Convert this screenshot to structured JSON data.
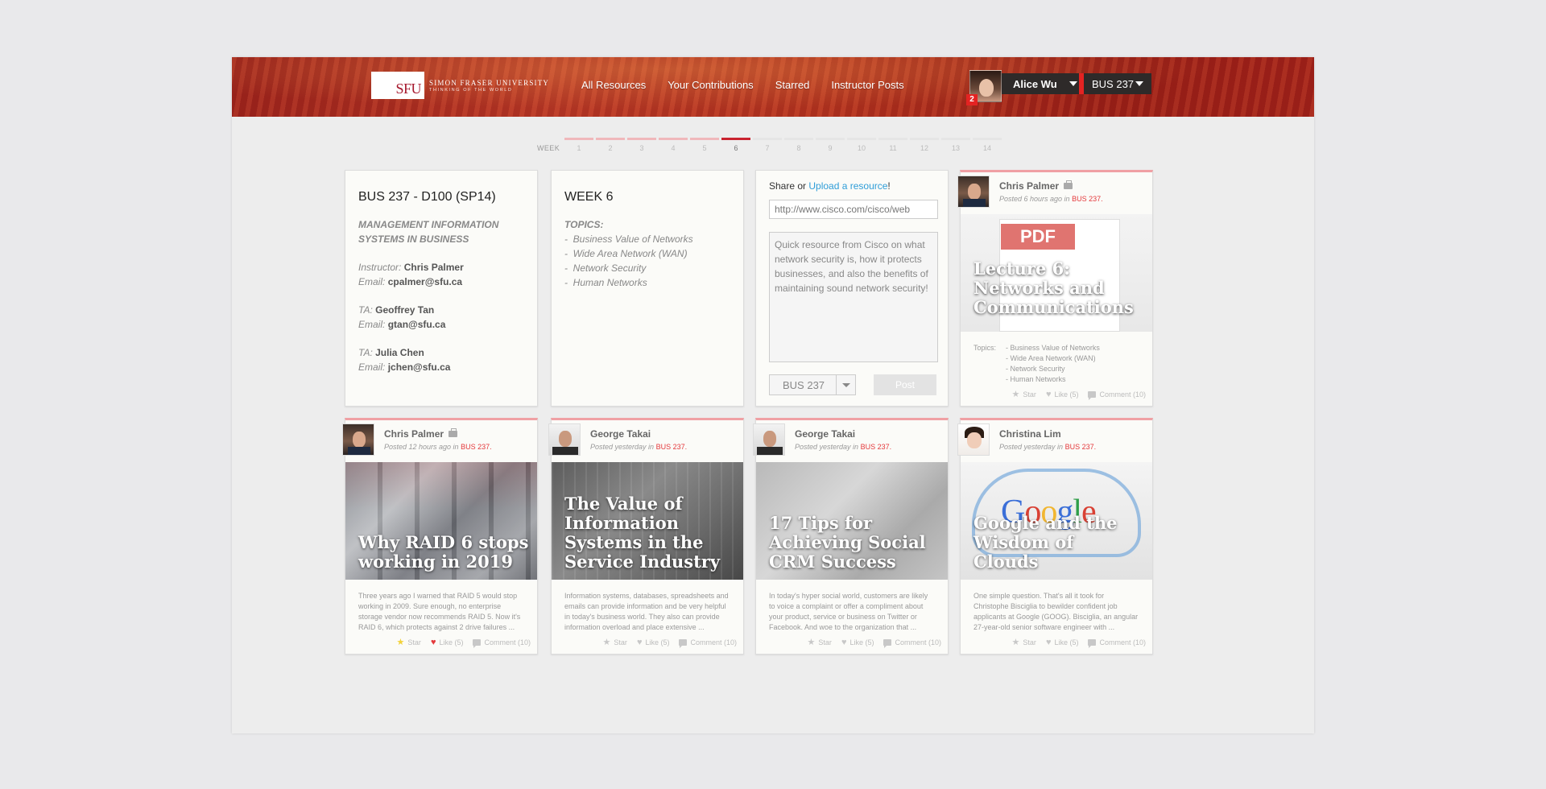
{
  "header": {
    "logo_mark": "SFU",
    "logo_name": "Simon Fraser University",
    "logo_tagline": "Thinking of the World",
    "nav": [
      "All Resources",
      "Your Contributions",
      "Starred",
      "Instructor Posts"
    ],
    "user_name": "Alice Wu",
    "notification_count": "2",
    "course": "BUS 237"
  },
  "weeks": {
    "label": "WEEK",
    "items": [
      "1",
      "2",
      "3",
      "4",
      "5",
      "6",
      "7",
      "8",
      "9",
      "10",
      "11",
      "12",
      "13",
      "14"
    ],
    "current": 6
  },
  "course_card": {
    "title": "BUS 237 - D100 (SP14)",
    "subtitle": "MANAGEMENT INFORMATION SYSTEMS IN BUSINESS",
    "instructor_label": "Instructor:",
    "instructor": "Chris Palmer",
    "email_label": "Email:",
    "instructor_email": "cpalmer@sfu.ca",
    "ta_label": "TA:",
    "ta1": "Geoffrey Tan",
    "ta1_email": "gtan@sfu.ca",
    "ta2": "Julia Chen",
    "ta2_email": "jchen@sfu.ca"
  },
  "week_card": {
    "title": "WEEK 6",
    "topics_label": "TOPICS:",
    "topics": [
      "Business Value of Networks",
      "Wide Area Network (WAN)",
      "Network Security",
      "Human Networks"
    ]
  },
  "share_card": {
    "prefix": "Share or ",
    "link": "Upload a resource",
    "suffix": "!",
    "url_value": "http://www.cisco.com/cisco/web",
    "description": "Quick resource from Cisco on what network security is, how it protects businesses, and also the benefits of maintaining sound network security!",
    "course": "BUS 237",
    "post_label": "Post"
  },
  "posts": [
    {
      "author": "Chris Palmer",
      "meta": "Posted 6 hours ago in",
      "course": "BUS 237.",
      "pdf_label": "PDF",
      "title": "Lecture 6: Networks and Communications",
      "topics_label": "Topics:",
      "topics": [
        "- Business Value of Networks",
        "- Wide Area Network (WAN)",
        "- Network Security",
        "- Human Networks"
      ],
      "star": "Star",
      "like": "Like (5)",
      "comment": "Comment (10)"
    },
    {
      "author": "Chris Palmer",
      "meta": "Posted 12 hours ago in",
      "course": "BUS 237.",
      "title": "Why RAID 6 stops working in 2019",
      "excerpt": "Three years ago I warned that RAID 5 would stop working in 2009. Sure enough, no enterprise storage vendor now recommends RAID 5. Now it's RAID 6, which protects against 2 drive failures ...",
      "star": "Star",
      "like": "Like (5)",
      "comment": "Comment (10)"
    },
    {
      "author": "George Takai",
      "meta": "Posted yesterday in",
      "course": "BUS 237.",
      "title": "The Value of Information Systems in the Service Industry",
      "excerpt": "Information systems, databases, spreadsheets and emails can provide information and be very helpful in today's business world. They also can provide information overload and place extensive ...",
      "star": "Star",
      "like": "Like (5)",
      "comment": "Comment (10)"
    },
    {
      "author": "George Takai",
      "meta": "Posted yesterday in",
      "course": "BUS 237.",
      "title": "17 Tips for Achieving Social CRM Success",
      "excerpt": "In today's hyper social world, customers are likely to voice a complaint or offer a compliment about your product, service or business on Twitter or Facebook. And woe to the organization that ...",
      "star": "Star",
      "like": "Like (5)",
      "comment": "Comment (10)"
    },
    {
      "author": "Christina Lim",
      "meta": "Posted yesterday in",
      "course": "BUS 237.",
      "title": "Google and the Wisdom of Clouds",
      "excerpt": "One simple question. That's all it took for Christophe Bisciglia to bewilder confident job applicants at Google (GOOG). Bisciglia, an angular 27-year-old senior software engineer with ...",
      "star": "Star",
      "like": "Like (5)",
      "comment": "Comment (10)"
    }
  ],
  "colors": {
    "accent": "#e4393c",
    "link": "#2f9dd8",
    "header": "#b4321f"
  }
}
